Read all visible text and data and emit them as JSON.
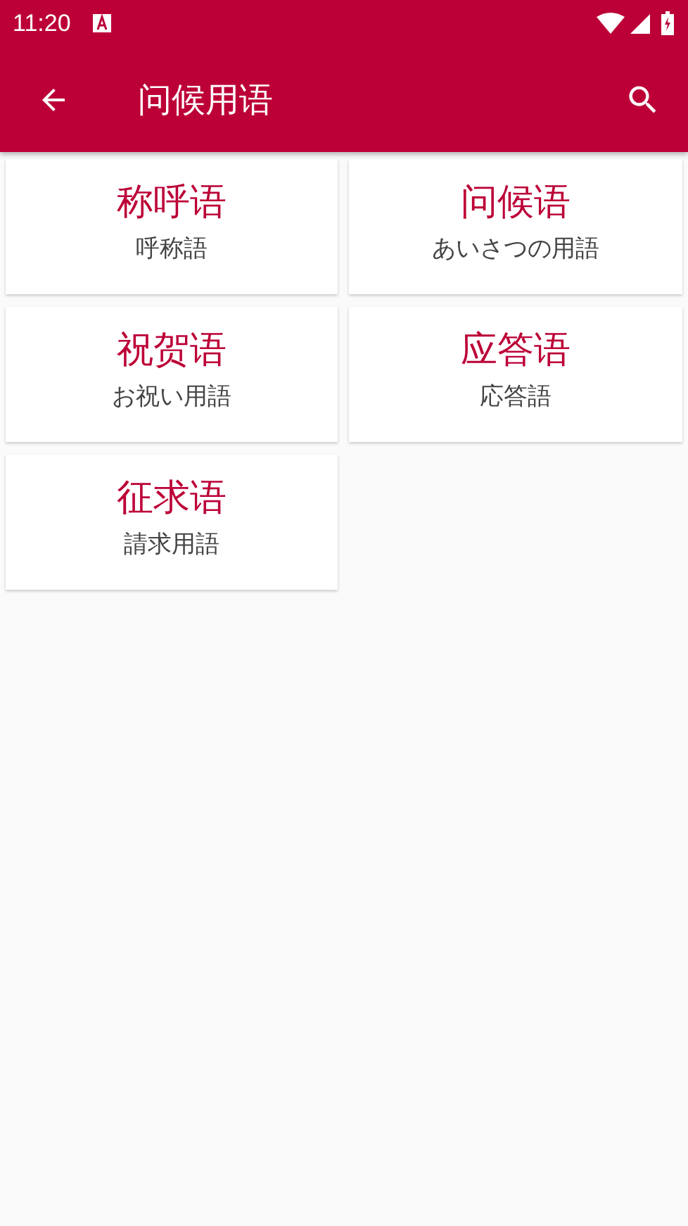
{
  "status_bar": {
    "time": "11:20"
  },
  "app_bar": {
    "title": "问候用语"
  },
  "categories": [
    {
      "title": "称呼语",
      "subtitle": "呼称語"
    },
    {
      "title": "问候语",
      "subtitle": "あいさつの用語"
    },
    {
      "title": "祝贺语",
      "subtitle": "お祝い用語"
    },
    {
      "title": "应答语",
      "subtitle": "応答語"
    },
    {
      "title": "征求语",
      "subtitle": "請求用語"
    }
  ]
}
